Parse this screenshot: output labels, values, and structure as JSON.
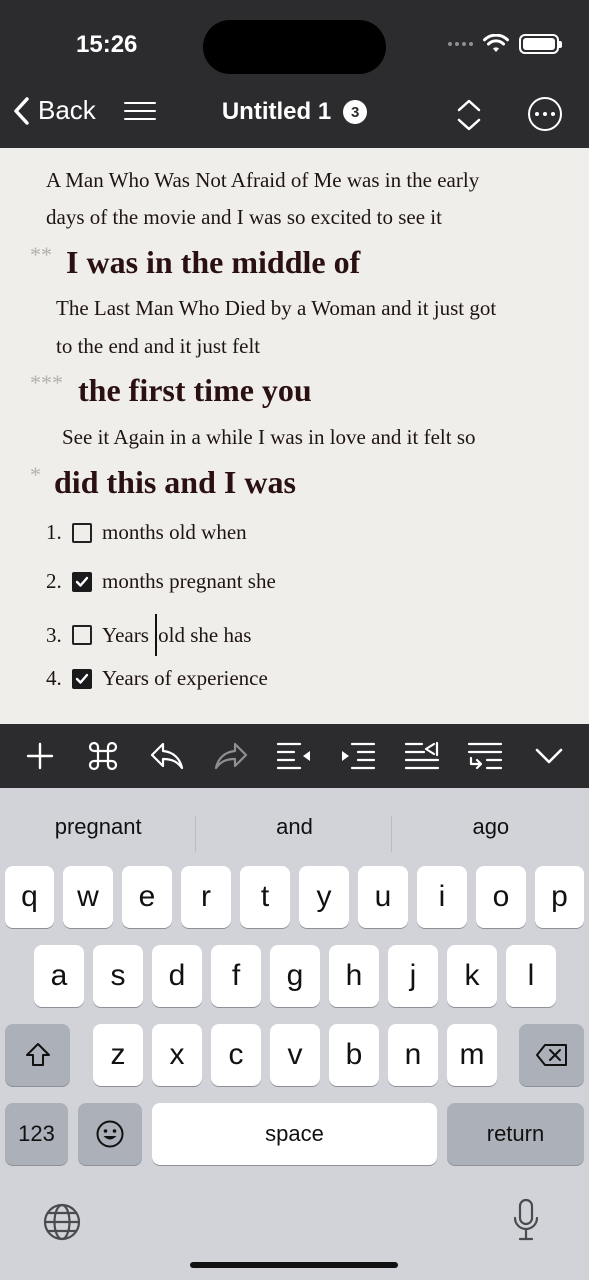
{
  "status": {
    "time": "15:26"
  },
  "nav": {
    "back_label": "Back",
    "title": "Untitled 1",
    "badge": "3"
  },
  "document": {
    "p1_line1": "A Man Who Was Not Afraid of Me was in the early",
    "p1_line2": "days of the movie and I was so excited to see it",
    "h1_marker": "**",
    "h1": "I was in the middle of",
    "p2_line1": "The Last Man Who Died by a Woman and it just got",
    "p2_line2": "to the end and it just felt",
    "h2_marker": "***",
    "h2": "the first time you",
    "p3": "See it Again in a while I was in love and it felt so",
    "h3_marker": "*",
    "h3": "did this and I was",
    "list": [
      {
        "num": "1.",
        "checked": false,
        "text": "months old when"
      },
      {
        "num": "2.",
        "checked": true,
        "text": "months pregnant she"
      },
      {
        "num": "3.",
        "checked": false,
        "text_before": "Years ",
        "text_after": "old she has"
      },
      {
        "num": "4.",
        "checked": true,
        "text": "Years of experience"
      }
    ]
  },
  "toolbar": [
    "plus-icon",
    "command-icon",
    "undo-icon",
    "redo-icon",
    "outdent-icon",
    "indent-icon",
    "move-right-icon",
    "move-left-icon",
    "dismiss-keyboard-icon"
  ],
  "keyboard": {
    "suggestions": [
      "pregnant",
      "and",
      "ago"
    ],
    "row1": [
      "q",
      "w",
      "e",
      "r",
      "t",
      "y",
      "u",
      "i",
      "o",
      "p"
    ],
    "row2": [
      "a",
      "s",
      "d",
      "f",
      "g",
      "h",
      "j",
      "k",
      "l"
    ],
    "row3": [
      "z",
      "x",
      "c",
      "v",
      "b",
      "n",
      "m"
    ],
    "numbers_label": "123",
    "space_label": "space",
    "return_label": "return"
  }
}
